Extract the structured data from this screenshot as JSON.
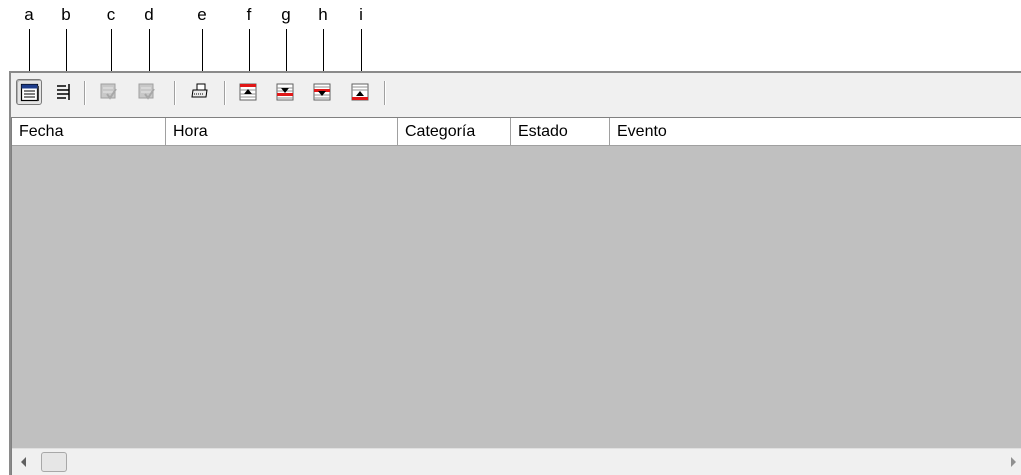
{
  "callouts": [
    "a",
    "b",
    "c",
    "d",
    "e",
    "f",
    "g",
    "h",
    "i"
  ],
  "toolbar": {
    "buttons": [
      {
        "icon": "event-log-icon",
        "state": "pressed"
      },
      {
        "icon": "tree-view-icon",
        "state": "enabled"
      },
      {
        "icon": "acknowledge-icon",
        "state": "disabled"
      },
      {
        "icon": "acknowledge-all-icon",
        "state": "disabled"
      },
      {
        "icon": "printer-icon",
        "state": "enabled"
      },
      {
        "icon": "first-record-icon",
        "state": "enabled"
      },
      {
        "icon": "next-record-icon",
        "state": "enabled"
      },
      {
        "icon": "previous-record-icon",
        "state": "enabled"
      },
      {
        "icon": "last-record-icon",
        "state": "enabled"
      }
    ]
  },
  "table": {
    "columns": [
      "Fecha",
      "Hora",
      "Categoría",
      "Estado",
      "Evento"
    ],
    "rows": []
  },
  "colors": {
    "grid_background": "#c0c0c0",
    "accent_red": "#e01818"
  }
}
